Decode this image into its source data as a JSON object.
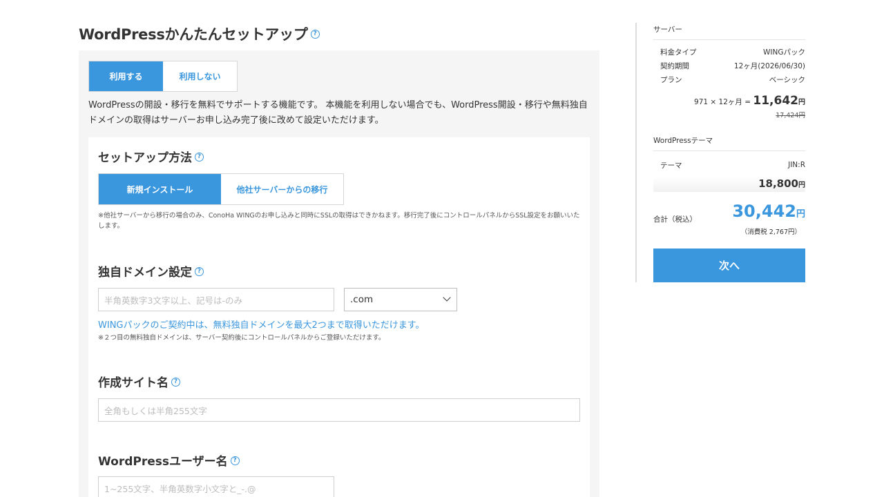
{
  "page": {
    "title": "WordPressかんたんセットアップ",
    "help_glyph": "?"
  },
  "use_toggle": {
    "use_label": "利用する",
    "no_use_label": "利用しない",
    "selected": "利用する"
  },
  "description": "WordPressの開設・移行を無料でサポートする機能です。 本機能を利用しない場合でも、WordPress開設・移行や無料独自ドメインの取得はサーバーお申し込み完了後に改めて設定いただけます。",
  "setup_method": {
    "title": "セットアップ方法",
    "new_install_label": "新規インストール",
    "migrate_label": "他社サーバーからの移行",
    "selected": "新規インストール",
    "note": "※他社サーバーから移行の場合のみ、ConoHa WINGのお申し込みと同時にSSLの取得はできかねます。移行完了後にコントロールパネルからSSL設定をお願いいたします。"
  },
  "domain": {
    "title": "独自ドメイン設定",
    "placeholder": "半角英数字3文字以上、記号は-のみ",
    "tld_selected": ".com",
    "promo": "WINGパックのご契約中は、無料独自ドメインを最大2つまで取得いただけます。",
    "note": "※２つ目の無料独自ドメインは、サーバー契約後にコントロールパネルからご登録いただけます。"
  },
  "site_name": {
    "title": "作成サイト名",
    "placeholder": "全角もしくは半角255文字"
  },
  "wp_user": {
    "title": "WordPressユーザー名",
    "placeholder": "1~255文字、半角英数字小文字と_-.@"
  },
  "sidebar": {
    "server_head": "サーバー",
    "rows": [
      {
        "label": "料金タイプ",
        "value": "WINGパック"
      },
      {
        "label": "契約期間",
        "value": "12ヶ月(2026/06/30)"
      },
      {
        "label": "プラン",
        "value": "ベーシック"
      }
    ],
    "calc_prefix": "971 × 12ヶ月 = ",
    "calc_total": "11,642",
    "yen": "円",
    "original_price": "17,424円",
    "theme_head": "WordPressテーマ",
    "theme_row": {
      "label": "テーマ",
      "value": "JIN:R"
    },
    "theme_price": "18,800",
    "total_label": "合計（税込）",
    "total_value": "30,442",
    "tax_note": "（消費税 2,767円）",
    "next_label": "次へ"
  },
  "colors": {
    "accent": "#3a96dd",
    "panel_bg": "#f5f5f5"
  }
}
